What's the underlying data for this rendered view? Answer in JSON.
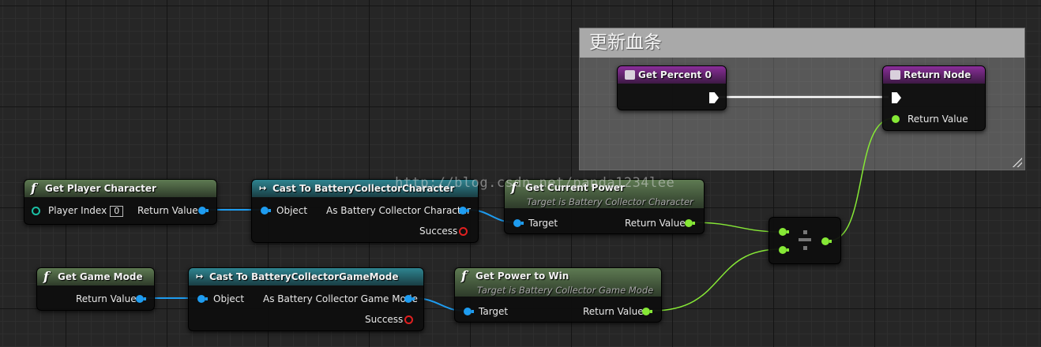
{
  "comment": {
    "title": "更新血条"
  },
  "nodes": {
    "get_percent": {
      "title": "Get Percent 0"
    },
    "return_node": {
      "title": "Return Node",
      "pin_return_value": "Return Value"
    },
    "get_player_character": {
      "title": "Get Player Character",
      "pin_player_index": "Player Index",
      "player_index_value": "0",
      "pin_return_value": "Return Value"
    },
    "cast_character": {
      "title": "Cast To BatteryCollectorCharacter",
      "pin_object": "Object",
      "pin_as": "As Battery Collector Character",
      "pin_success": "Success"
    },
    "get_current_power": {
      "title": "Get Current Power",
      "subtitle": "Target is Battery Collector Character",
      "pin_target": "Target",
      "pin_return_value": "Return Value"
    },
    "get_game_mode": {
      "title": "Get Game Mode",
      "pin_return_value": "Return Value"
    },
    "cast_game_mode": {
      "title": "Cast To BatteryCollectorGameMode",
      "pin_object": "Object",
      "pin_as": "As Battery Collector Game Mode",
      "pin_success": "Success"
    },
    "get_power_to_win": {
      "title": "Get Power to Win",
      "subtitle": "Target is Battery Collector Game Mode",
      "pin_target": "Target",
      "pin_return_value": "Return Value"
    },
    "divide": {
      "operator": "÷"
    }
  },
  "watermark": "http://blog.csdn.net/panda1234lee",
  "colors": {
    "object_pin": "#1e9cf0",
    "float_pin": "#86e836",
    "exec_pin": "#ffffff",
    "success_pin": "#e02020"
  },
  "icons": {
    "function": "f",
    "cast": "→",
    "return": "return-node-icon",
    "entry": "function-entry-icon"
  }
}
